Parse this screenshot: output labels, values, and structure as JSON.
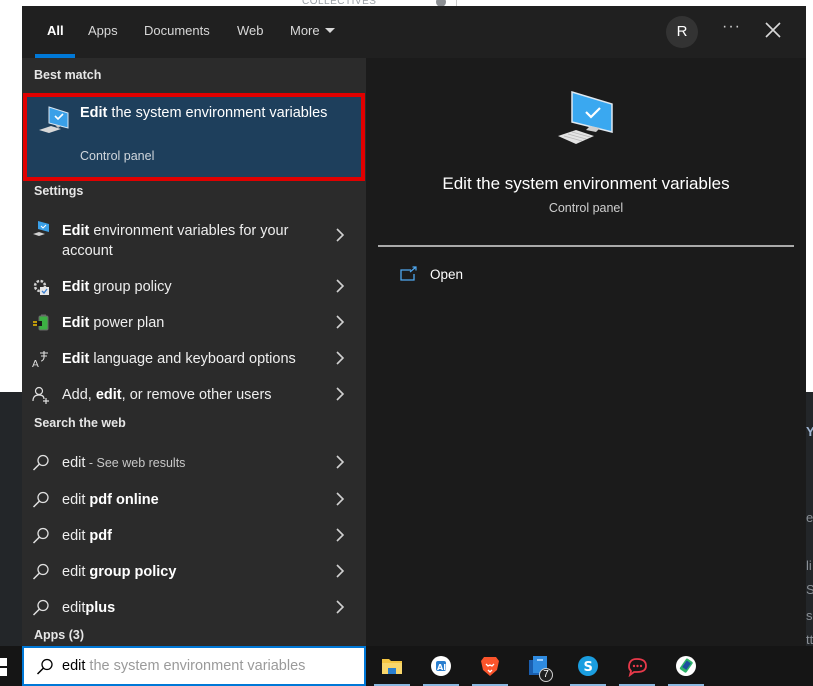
{
  "background": {
    "partial_text": "COLLECTIVES",
    "right_edge_fragments": [
      "Y",
      "e",
      "li",
      "Se",
      "s",
      "tt"
    ]
  },
  "tabs": [
    {
      "label": "All",
      "active": true
    },
    {
      "label": "Apps",
      "active": false
    },
    {
      "label": "Documents",
      "active": false
    },
    {
      "label": "Web",
      "active": false
    },
    {
      "label": "More",
      "active": false
    }
  ],
  "header": {
    "avatar_initial": "R",
    "more_options_label": "···",
    "close_icon": "close-icon"
  },
  "sections": {
    "best_match": "Best match",
    "settings": "Settings",
    "search_web": "Search the web",
    "apps": "Apps (3)"
  },
  "best_match": {
    "title_bold": "Edit",
    "title_rest": " the system environment variables",
    "subtitle": "Control panel",
    "icon": "computer-monitor-icon",
    "highlight_color": "#e00000"
  },
  "settings_items": [
    {
      "bold": "Edit",
      "rest": " environment variables for your account",
      "icon": "computer-monitor-icon"
    },
    {
      "bold": "Edit",
      "rest": " group policy",
      "icon": "group-policy-icon"
    },
    {
      "bold": "Edit",
      "rest": " power plan",
      "icon": "power-plan-icon"
    },
    {
      "bold": "Edit",
      "rest": " language and keyboard options",
      "icon": "language-icon"
    },
    {
      "pre": "Add, ",
      "bold": "edit",
      "rest": ", or remove other users",
      "icon": "user-add-icon"
    }
  ],
  "web_items": [
    {
      "plain": "edit",
      "hint": " - See web results",
      "bold": ""
    },
    {
      "plain": "edit ",
      "hint": "",
      "bold": "pdf online"
    },
    {
      "plain": "edit ",
      "hint": "",
      "bold": "pdf"
    },
    {
      "plain": "edit ",
      "hint": "",
      "bold": "group policy"
    },
    {
      "plain": "edit",
      "hint": "",
      "bold": "plus"
    }
  ],
  "preview": {
    "title": "Edit the system environment variables",
    "subtitle": "Control panel",
    "actions": [
      {
        "label": "Open",
        "icon": "open-external-icon"
      }
    ]
  },
  "search_box": {
    "typed": "edit",
    "suggestion": " the system environment variables"
  },
  "taskbar": {
    "apps": [
      {
        "name": "file-explorer",
        "running": true
      },
      {
        "name": "ai-assistant",
        "running": true
      },
      {
        "name": "brave-browser",
        "running": true
      },
      {
        "name": "windows-app",
        "running": false,
        "badge": "7"
      },
      {
        "name": "skype",
        "running": true
      },
      {
        "name": "rocket-chat",
        "running": true
      },
      {
        "name": "phone-link",
        "running": true
      }
    ]
  },
  "colors": {
    "accent": "#0078d7",
    "flyout_bg": "#202020",
    "results_bg": "#2b2b2b",
    "preview_bg": "#1b1b1b",
    "selected_bg": "#1e3f5c"
  }
}
